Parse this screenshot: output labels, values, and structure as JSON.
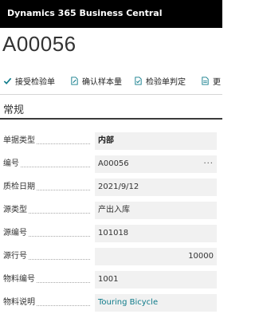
{
  "app": {
    "title": "Dynamics 365 Business Central"
  },
  "record": {
    "title": "A00056"
  },
  "actions": [
    {
      "label": "接受检验单",
      "icon": "checkmark-icon"
    },
    {
      "label": "确认样本量",
      "icon": "document-edit-icon"
    },
    {
      "label": "检验单判定",
      "icon": "document-check-icon"
    },
    {
      "label": "更",
      "icon": "document-icon"
    }
  ],
  "section": {
    "title": "常规"
  },
  "fields": [
    {
      "label": "单据类型",
      "value": "内部"
    },
    {
      "label": "编号",
      "value": "A00056",
      "assist": "···"
    },
    {
      "label": "质检日期",
      "value": "2021/9/12"
    },
    {
      "label": "源类型",
      "value": "产出入库"
    },
    {
      "label": "源编号",
      "value": "101018"
    },
    {
      "label": "源行号",
      "value": "10000"
    },
    {
      "label": "物料编号",
      "value": "1001"
    },
    {
      "label": "物料说明",
      "value": "Touring Bicycle"
    }
  ],
  "colors": {
    "topbar": "#000000",
    "accent": "#0f7b8a",
    "field_bg": "#f1f1f1"
  }
}
